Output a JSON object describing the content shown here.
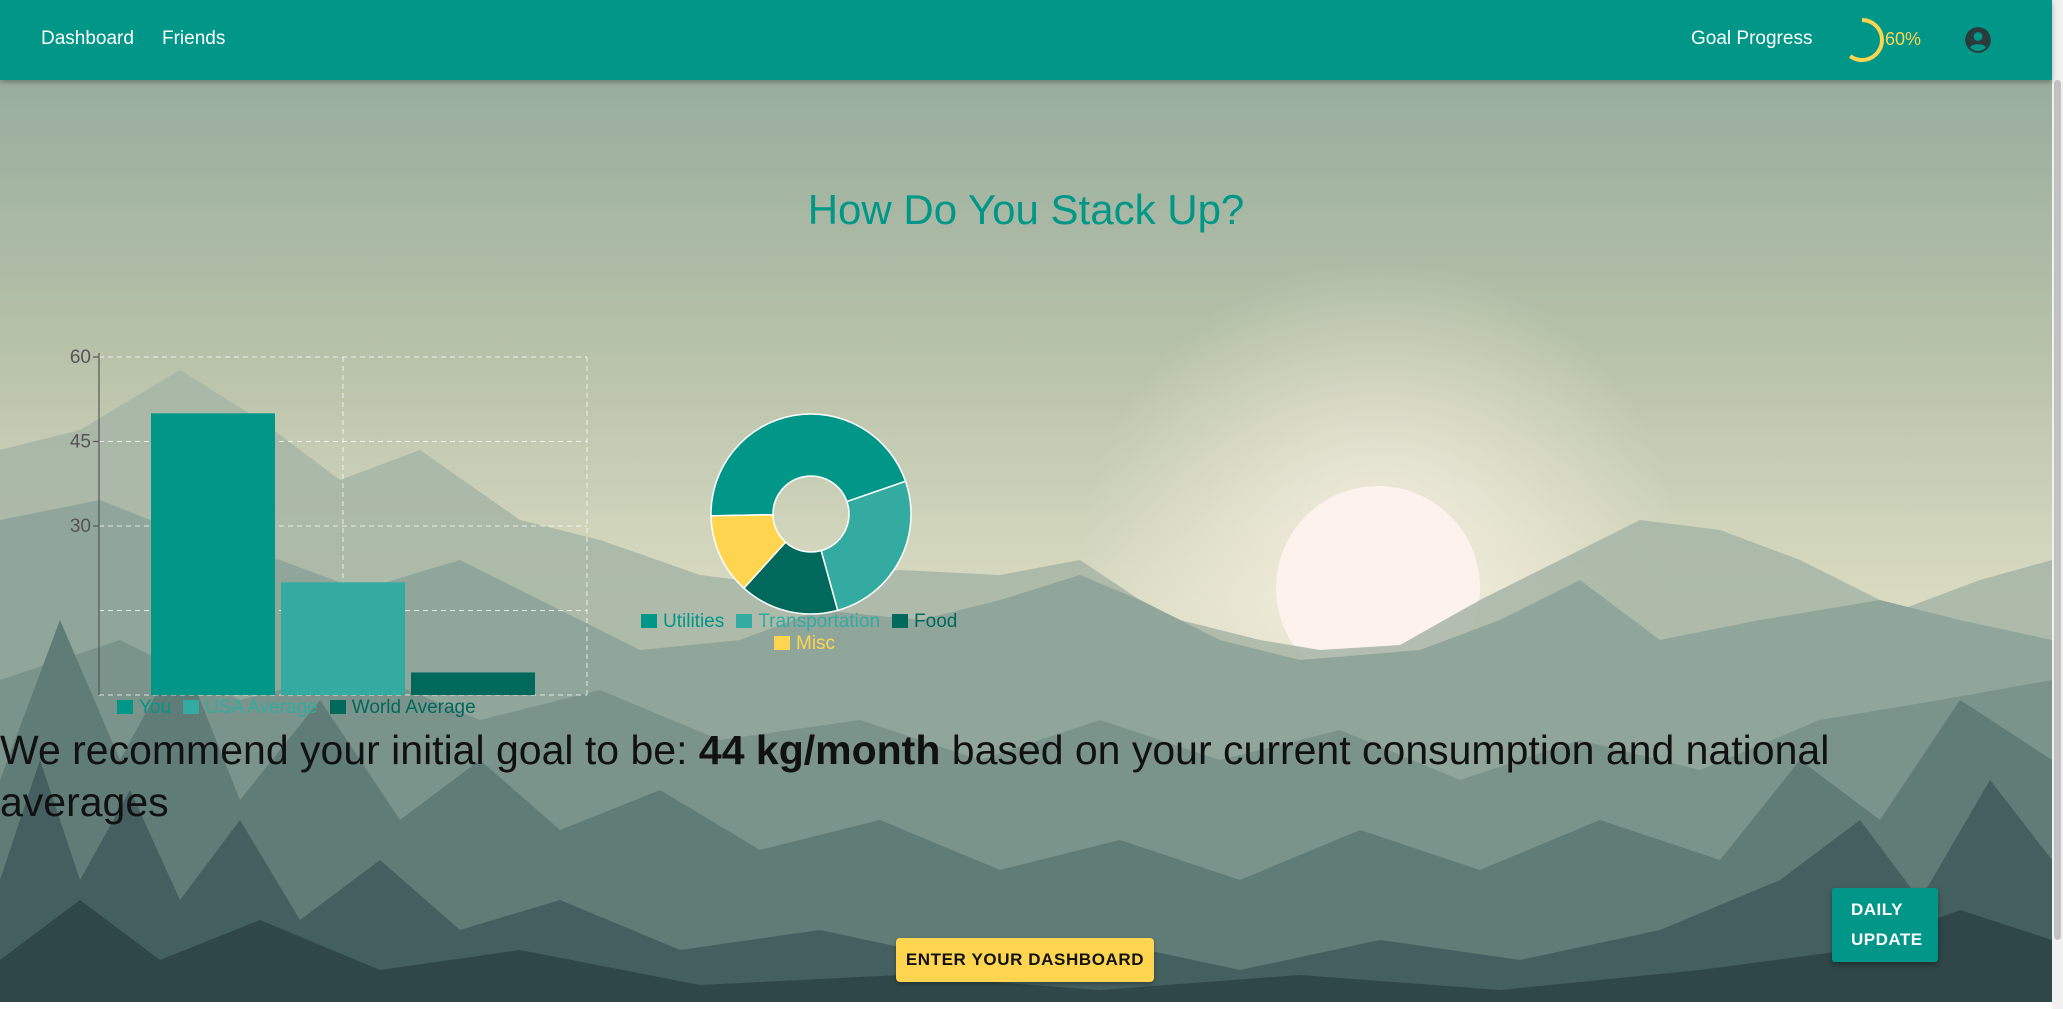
{
  "nav": {
    "links": [
      "Dashboard",
      "Friends"
    ],
    "goal_label": "Goal Progress",
    "goal_progress": 0.6,
    "goal_value_text": "60%",
    "account_icon": "account-circle-icon"
  },
  "main": {
    "title": "How Do You Stack Up?",
    "recommendation": {
      "prefix": "We recommend your initial goal to be:",
      "goal": "44 kg/month",
      "suffix": "based on your current consumption and national averages"
    }
  },
  "buttons": {
    "enter_dashboard": "ENTER YOUR DASHBOARD",
    "daily_update": "DAILY UPDATE"
  },
  "colors": {
    "primary": "#009688",
    "accent": "#ffd54f",
    "teal_light": "#33aba0",
    "teal_dark": "#00695c"
  },
  "chart_data": [
    {
      "type": "bar",
      "categories": [
        "You",
        "USA Average",
        "World Average"
      ],
      "values": [
        50,
        20,
        4
      ],
      "ylim": [
        0,
        60
      ],
      "yticks": [
        "30",
        "45",
        "60"
      ],
      "legend": [
        "You",
        "USA Average",
        "World Average"
      ],
      "legend_position": "bottom",
      "grid": true,
      "colors": [
        "#009688",
        "#33aba0",
        "#00695c"
      ]
    },
    {
      "type": "pie",
      "style": "donut",
      "labels": [
        "Utilities",
        "Transportation",
        "Food",
        "Misc"
      ],
      "values": [
        45,
        26,
        16,
        13
      ],
      "legend_position": "bottom",
      "colors": [
        "#009688",
        "#33aba0",
        "#00695c",
        "#ffd54f"
      ]
    }
  ]
}
